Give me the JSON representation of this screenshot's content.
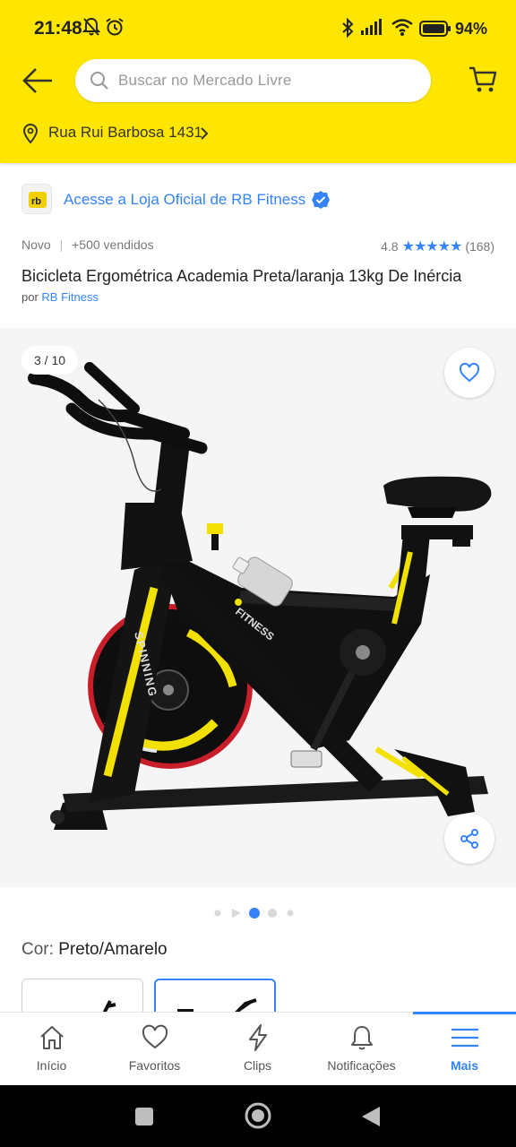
{
  "status_bar": {
    "time": "21:48",
    "battery": "94%"
  },
  "header": {
    "search_placeholder": "Buscar no Mercado Livre",
    "address": "Rua Rui Barbosa 1431"
  },
  "store": {
    "link_text": "Acesse a Loja Oficial de RB Fitness"
  },
  "product": {
    "condition": "Novo",
    "separator": "|",
    "sold": "+500 vendidos",
    "rating_value": "4.8",
    "rating_fraction": 0.96,
    "stars": "★★★★★",
    "review_count": "(168)",
    "title": "Bicicleta Ergométrica Academia Preta/laranja 13kg De Inércia",
    "by_prefix": "por",
    "seller": "RB Fitness"
  },
  "gallery": {
    "counter": "3 / 10",
    "current_index": 3,
    "total": 10,
    "bike_frame_text": "SPINNING",
    "bike_brand_text": "FITNESS"
  },
  "variant": {
    "label": "Cor:",
    "value": "Preto/Amarelo"
  },
  "tabbar": {
    "tabs": [
      {
        "label": "Início",
        "icon": "home-icon"
      },
      {
        "label": "Favoritos",
        "icon": "heart-icon"
      },
      {
        "label": "Clips",
        "icon": "lightning-icon"
      },
      {
        "label": "Notificações",
        "icon": "bell-icon"
      },
      {
        "label": "Mais",
        "icon": "menu-icon"
      }
    ],
    "active_index": 4
  },
  "colors": {
    "brand_yellow": "#ffe600",
    "link_blue": "#3483fa",
    "bike_yellow": "#f2e000",
    "bike_red": "#c81e2a"
  }
}
